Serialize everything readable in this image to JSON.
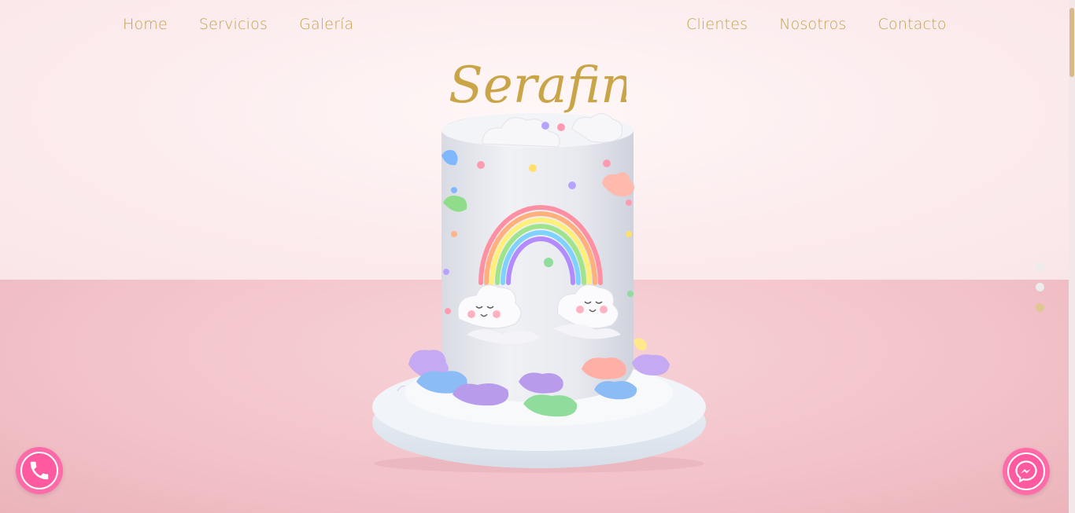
{
  "nav": {
    "left": [
      {
        "label": "Home"
      },
      {
        "label": "Servicios"
      },
      {
        "label": "Galería"
      }
    ],
    "right": [
      {
        "label": "Clientes"
      },
      {
        "label": "Nosotros"
      },
      {
        "label": "Contacto"
      }
    ]
  },
  "brand": {
    "logo_text": "Serafina",
    "accent_color": "#c4a24f"
  },
  "hero": {
    "image_subject": "rainbow-cloud-cake"
  },
  "slider": {
    "slide_count": 3,
    "active_index": 2
  },
  "floating_buttons": {
    "phone_icon": "phone-icon",
    "messenger_icon": "messenger-icon",
    "color": "#ff5aa0"
  }
}
